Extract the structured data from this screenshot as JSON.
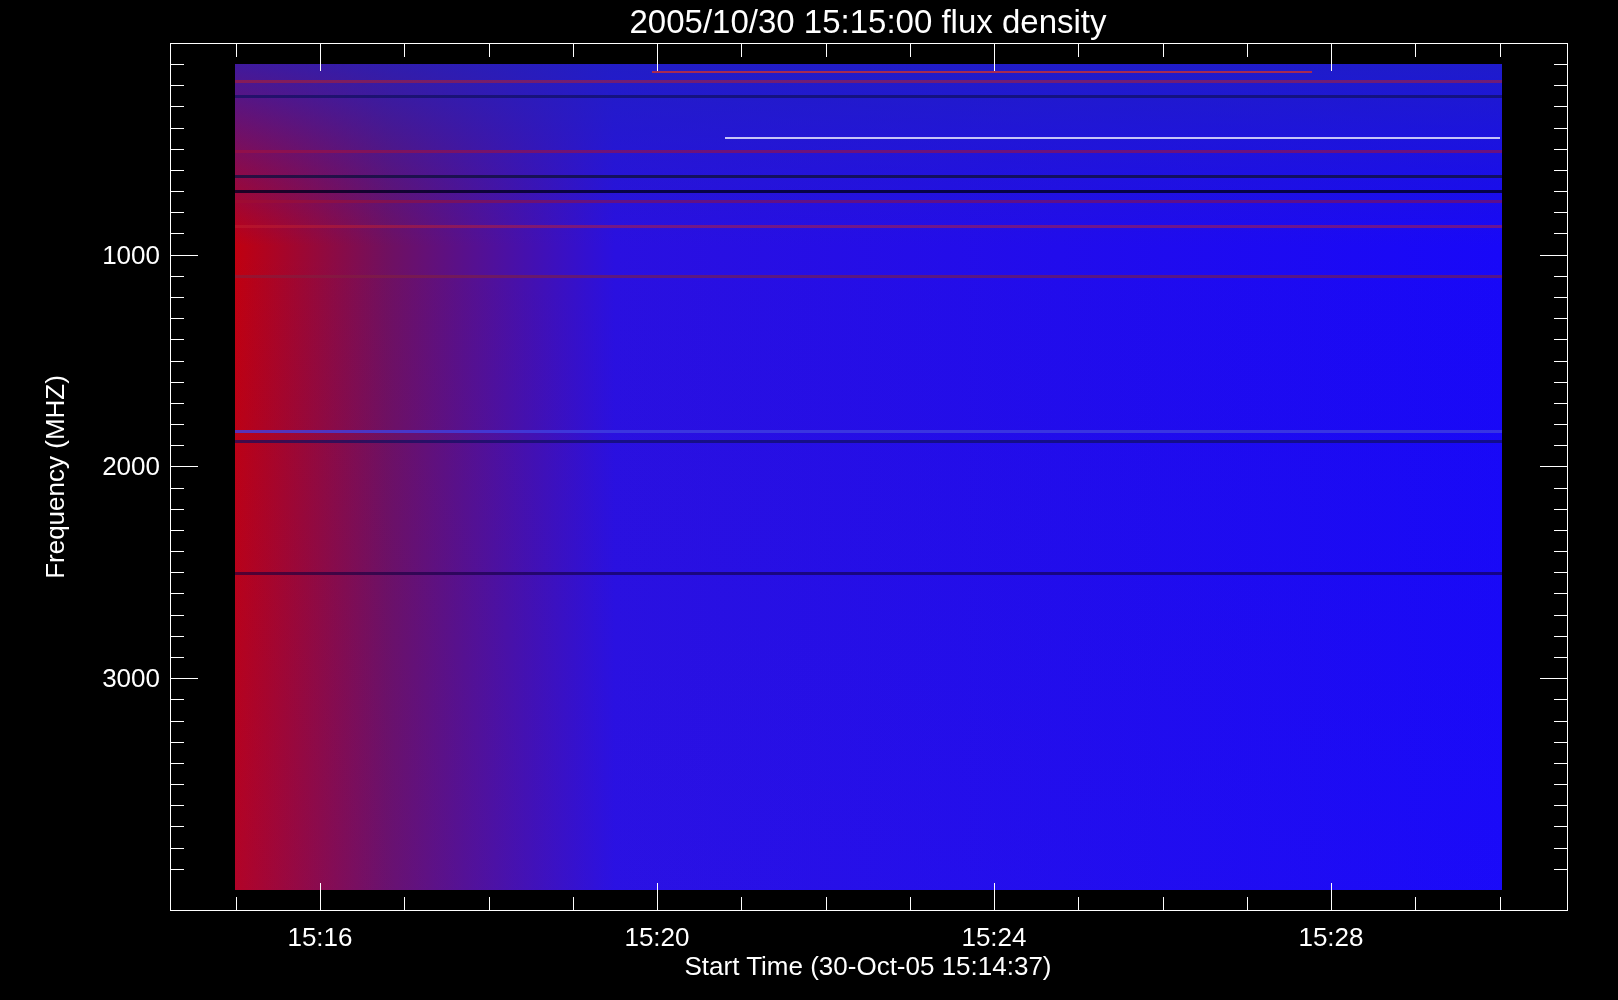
{
  "title": "2005/10/30 15:15:00 flux density",
  "y_axis": {
    "label": "Frequency (MHZ)",
    "ticks": [
      "1000",
      "2000",
      "3000"
    ]
  },
  "x_axis": {
    "label": "Start Time (30-Oct-05 15:14:37)",
    "ticks": [
      "15:16",
      "15:20",
      "15:24",
      "15:28"
    ]
  }
}
